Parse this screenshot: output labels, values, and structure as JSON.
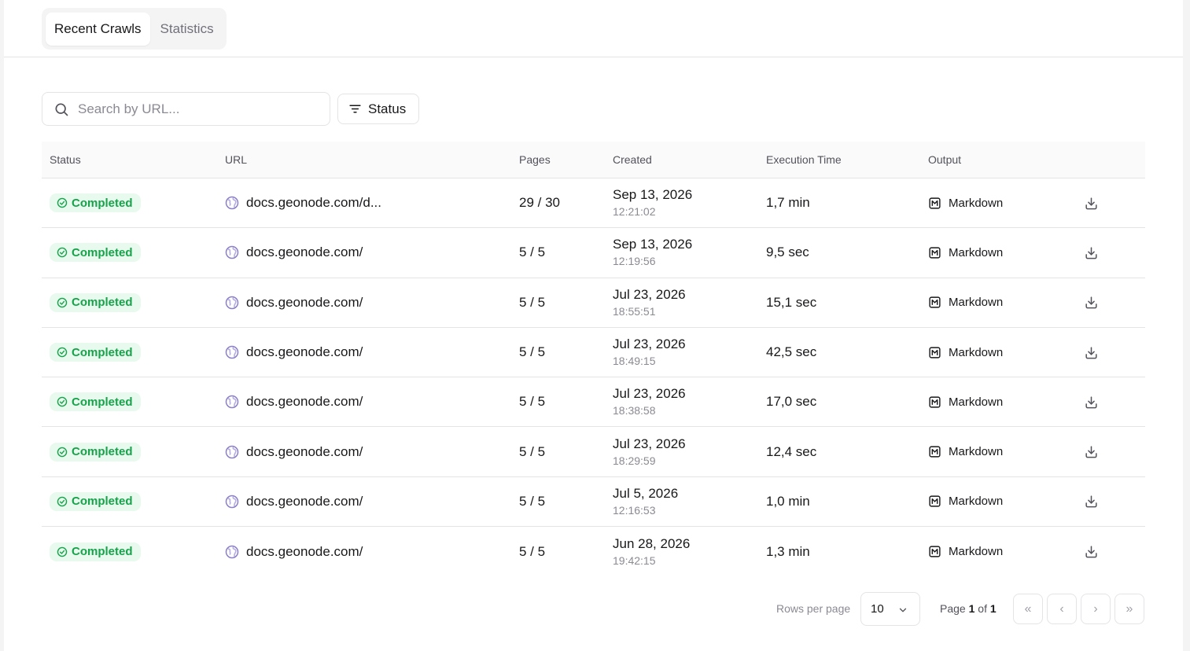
{
  "tabs": [
    {
      "label": "Recent Crawls",
      "active": true
    },
    {
      "label": "Statistics",
      "active": false
    }
  ],
  "search": {
    "placeholder": "Search by URL..."
  },
  "filter": {
    "status_label": "Status"
  },
  "table": {
    "headers": {
      "status": "Status",
      "url": "URL",
      "pages": "Pages",
      "created": "Created",
      "execution_time": "Execution Time",
      "output": "Output"
    },
    "rows": [
      {
        "status": "Completed",
        "url": "docs.geonode.com/d...",
        "pages": "29 / 30",
        "date": "Sep 13, 2026",
        "time": "12:21:02",
        "exec": "1,7 min",
        "output": "Markdown"
      },
      {
        "status": "Completed",
        "url": "docs.geonode.com/",
        "pages": "5 / 5",
        "date": "Sep 13, 2026",
        "time": "12:19:56",
        "exec": "9,5 sec",
        "output": "Markdown"
      },
      {
        "status": "Completed",
        "url": "docs.geonode.com/",
        "pages": "5 / 5",
        "date": "Jul 23, 2026",
        "time": "18:55:51",
        "exec": "15,1 sec",
        "output": "Markdown"
      },
      {
        "status": "Completed",
        "url": "docs.geonode.com/",
        "pages": "5 / 5",
        "date": "Jul 23, 2026",
        "time": "18:49:15",
        "exec": "42,5 sec",
        "output": "Markdown"
      },
      {
        "status": "Completed",
        "url": "docs.geonode.com/",
        "pages": "5 / 5",
        "date": "Jul 23, 2026",
        "time": "18:38:58",
        "exec": "17,0 sec",
        "output": "Markdown"
      },
      {
        "status": "Completed",
        "url": "docs.geonode.com/",
        "pages": "5 / 5",
        "date": "Jul 23, 2026",
        "time": "18:29:59",
        "exec": "12,4 sec",
        "output": "Markdown"
      },
      {
        "status": "Completed",
        "url": "docs.geonode.com/",
        "pages": "5 / 5",
        "date": "Jul 5, 2026",
        "time": "12:16:53",
        "exec": "1,0 min",
        "output": "Markdown"
      },
      {
        "status": "Completed",
        "url": "docs.geonode.com/",
        "pages": "5 / 5",
        "date": "Jun 28, 2026",
        "time": "19:42:15",
        "exec": "1,3 min",
        "output": "Markdown"
      }
    ]
  },
  "pagination": {
    "rows_per_page_label": "Rows per page",
    "rows_per_page_value": "10",
    "page_prefix": "Page",
    "current_page": "1",
    "of_label": "of",
    "total_pages": "1",
    "first": "«",
    "prev": "‹",
    "next": "›",
    "last": "»"
  },
  "colors": {
    "success": "#16a34a",
    "success_bg": "#e8f9ee",
    "globe": "#8b7fc7",
    "border": "#e4e4e7"
  },
  "icons": {
    "search": "search-icon",
    "filter": "filter-icon",
    "status_check": "check-circle-icon",
    "url_globe": "globe-icon",
    "output": "markdown-icon",
    "download": "download-icon",
    "chevron": "chevron-down-icon"
  }
}
